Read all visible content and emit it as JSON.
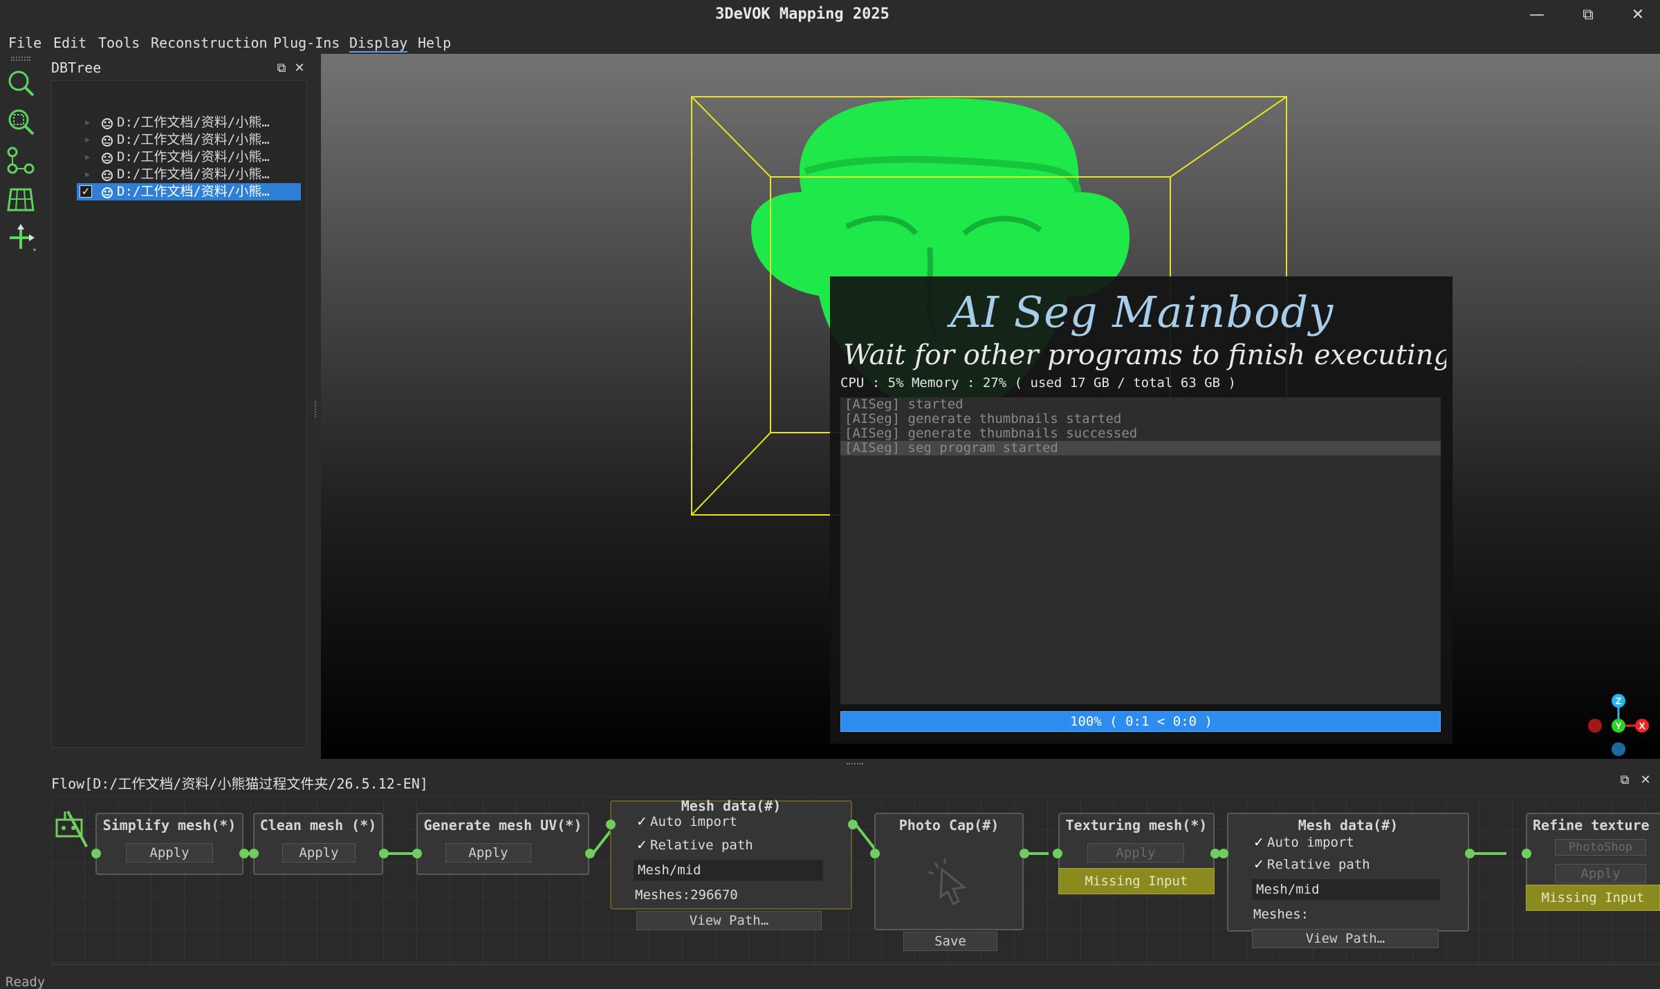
{
  "window": {
    "title": "3DeVOK Mapping 2025",
    "minimize": "—",
    "restore": "⧉",
    "close": "✕"
  },
  "menu": [
    "File",
    "Edit",
    "Tools",
    "Reconstruction",
    "Plug-Ins",
    "Display",
    "Help"
  ],
  "menu_active": "Display",
  "left_toolbar": {
    "tools": [
      "zoom-fit-icon",
      "zoom-selection-icon",
      "measure-points-icon",
      "mesh-grid-icon",
      "move-axis-icon"
    ]
  },
  "dbtree": {
    "title": "DBTree",
    "items": [
      {
        "label": "D:/工作文档/资料/小熊…",
        "checked": false,
        "selected": false
      },
      {
        "label": "D:/工作文档/资料/小熊…",
        "checked": false,
        "selected": false
      },
      {
        "label": "D:/工作文档/资料/小熊…",
        "checked": false,
        "selected": false
      },
      {
        "label": "D:/工作文档/资料/小熊…",
        "checked": false,
        "selected": false
      },
      {
        "label": "D:/工作文档/资料/小熊…",
        "checked": true,
        "selected": true
      }
    ],
    "check_mark": "✓"
  },
  "dialog": {
    "title": "AI Seg Mainbody",
    "subtitle": "Wait for other programs to finish executing",
    "stats": "CPU : 5%  Memory : 27% ( used 17 GB / total 63 GB )",
    "log": [
      "[AISeg] started",
      "[AISeg] generate thumbnails started",
      "[AISeg] generate thumbnails successed",
      "[AISeg] seg program started"
    ],
    "progress_percent": 100,
    "progress_text": "100% ( 0:1 < 0:0 )"
  },
  "axes": {
    "z": "Z",
    "y": "Y",
    "x": "X"
  },
  "flow": {
    "title": "Flow[D:/工作文档/资料/小熊猫过程文件夹/26.5.12-EN]",
    "nodes": {
      "simplify": {
        "title": "Simplify mesh(*)",
        "button": "Apply"
      },
      "clean": {
        "title": "Clean mesh (*)",
        "button": "Apply"
      },
      "uv": {
        "title": "Generate mesh UV(*)",
        "button": "Apply"
      },
      "mesh1": {
        "title": "Mesh data(#)",
        "auto_import": "Auto import",
        "relative_path": "Relative path",
        "path": "Mesh/mid",
        "meshes": "Meshes:296670",
        "view": "View Path…"
      },
      "photo": {
        "title": "Photo Cap(#)",
        "button": "Save"
      },
      "texturing": {
        "title": "Texturing mesh(*)",
        "button": "Apply",
        "warning": "Missing Input"
      },
      "mesh2": {
        "title": "Mesh data(#)",
        "auto_import": "Auto import",
        "relative_path": "Relative path",
        "path": "Mesh/mid",
        "meshes": "Meshes:",
        "view": "View Path…"
      },
      "refine": {
        "title": "Refine texture",
        "select": "PhotoShop",
        "button": "Apply",
        "warning": "Missing Input"
      }
    },
    "check_mark": "✓"
  },
  "status": "Ready",
  "colors": {
    "accent": "#2d8cf0",
    "model": "#1ee84a",
    "bbox": "#e6e61e",
    "link": "#6fce5f",
    "warning": "#8a8a1e"
  }
}
